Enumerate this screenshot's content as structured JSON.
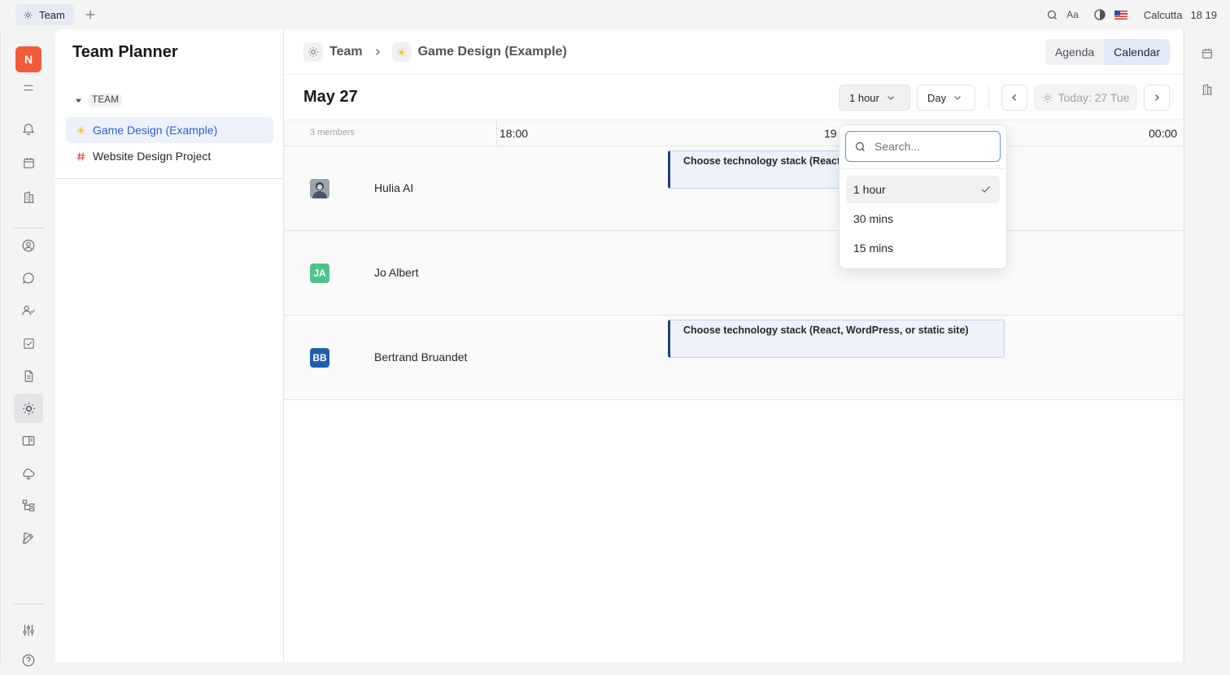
{
  "topbar": {
    "tab_label": "Team",
    "tab_icon": "sun-icon",
    "location": "Calcutta",
    "time": "18 19",
    "font_toggle_label": "Aa"
  },
  "rail": {
    "avatar_initial": "N",
    "avatar_color": "#f45b3b",
    "icons": [
      "menu-icon",
      "bell-icon",
      "calendar-icon",
      "building-icon",
      "user-circle-icon",
      "chat-icon",
      "users-icon",
      "checkbox-icon",
      "document-icon",
      "sun-icon",
      "book-icon",
      "cloud-icon",
      "hierarchy-icon",
      "edit-icon",
      "sliders-icon",
      "help-icon"
    ],
    "active_icon": "sun-icon"
  },
  "sidebar": {
    "title": "Team Planner",
    "group_label": "TEAM",
    "items": [
      {
        "label": "Game Design (Example)",
        "icon": "sun-emoji-icon",
        "active": true
      },
      {
        "label": "Website Design Project",
        "icon": "hash-icon",
        "active": false
      }
    ]
  },
  "header": {
    "breadcrumb_root": "Team",
    "breadcrumb_current": "Game Design (Example)",
    "views": [
      "Agenda",
      "Calendar"
    ],
    "active_view": "Calendar"
  },
  "toolbar": {
    "date_title": "May 27",
    "interval_value": "1 hour",
    "range_value": "Day",
    "today_label": "Today: 27 Tue"
  },
  "grid": {
    "members_count": "3 members",
    "time_labels": [
      "18:00",
      "19",
      "00:00"
    ],
    "rows": [
      {
        "name": "Hulia AI",
        "avatar": "photo",
        "event": "Choose technology stack (React, WordPress, or static site)"
      },
      {
        "name": "Jo Albert",
        "avatar": "JA",
        "avatar_color": "#4cc38a",
        "event": null
      },
      {
        "name": "Bertrand Bruandet",
        "avatar": "BB",
        "avatar_color": "#1f5fae",
        "event": "Choose technology stack (React, WordPress, or static site)"
      }
    ]
  },
  "dropdown": {
    "search_placeholder": "Search...",
    "options": [
      "1 hour",
      "30 mins",
      "15 mins"
    ],
    "selected": "1 hour"
  }
}
